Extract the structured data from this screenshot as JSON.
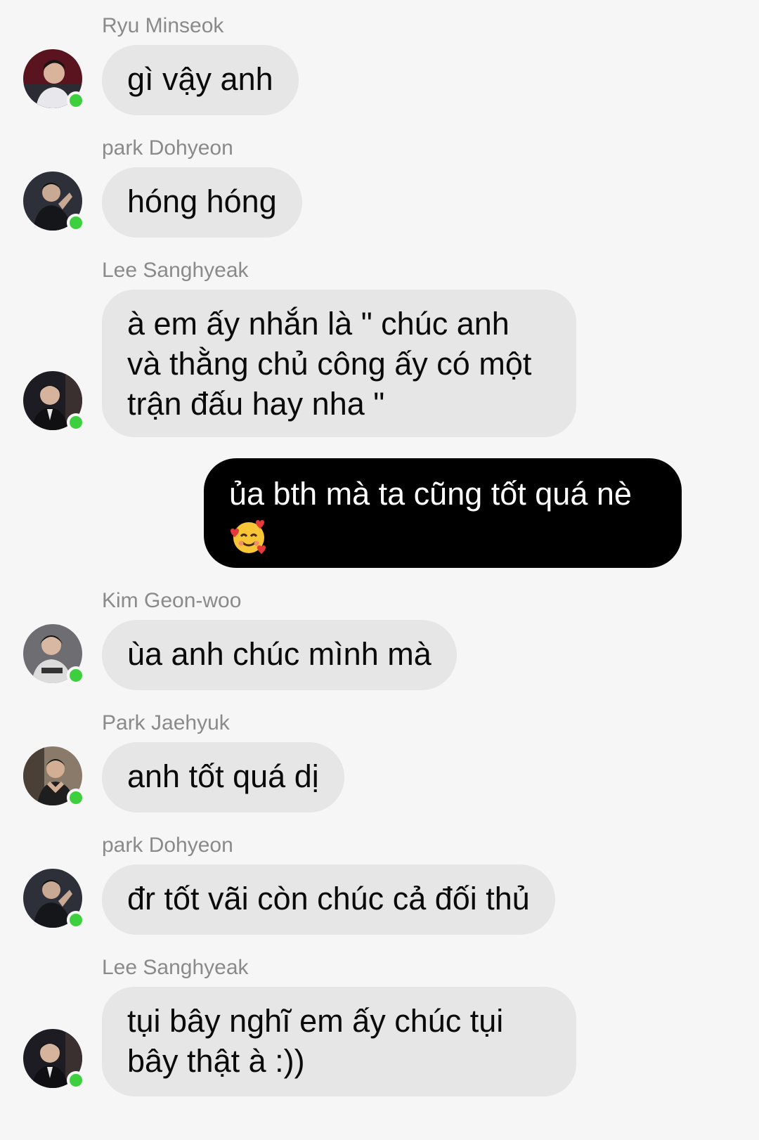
{
  "messages": [
    {
      "sender": "Ryu Minseok",
      "text": "gì vậy anh",
      "avatar_icon": "avatar-ryu-minseok"
    },
    {
      "sender": "park Dohyeon",
      "text": "hóng hóng",
      "avatar_icon": "avatar-park-dohyeon"
    },
    {
      "sender": "Lee Sanghyeak",
      "text": "à em ấy nhắn là \" chúc anh và thằng chủ công ấy có một trận đấu hay nha \"",
      "avatar_icon": "avatar-lee-sanghyeak"
    },
    {
      "sender": "",
      "mine": true,
      "text": "ủa bth mà ta cũng tốt quá nè",
      "emoji": "smiling-face-with-hearts-emoji"
    },
    {
      "sender": "Kim Geon-woo",
      "text": "ùa anh chúc mình mà",
      "avatar_icon": "avatar-kim-geon-woo"
    },
    {
      "sender": "Park Jaehyuk",
      "text": "anh tốt quá dị",
      "avatar_icon": "avatar-park-jaehyuk"
    },
    {
      "sender": "park Dohyeon",
      "text": "đr tốt vãi còn chúc cả đối thủ",
      "avatar_icon": "avatar-park-dohyeon"
    },
    {
      "sender": "Lee Sanghyeak",
      "text": "tụi bây nghĩ em ấy chúc tụi bây thật à :))",
      "avatar_icon": "avatar-lee-sanghyeak"
    }
  ],
  "colors": {
    "background": "#f6f6f6",
    "bubble_incoming": "#e6e6e6",
    "bubble_outgoing": "#000000",
    "sender_text": "#8a8a8a",
    "online_dot": "#3ecf3e"
  }
}
